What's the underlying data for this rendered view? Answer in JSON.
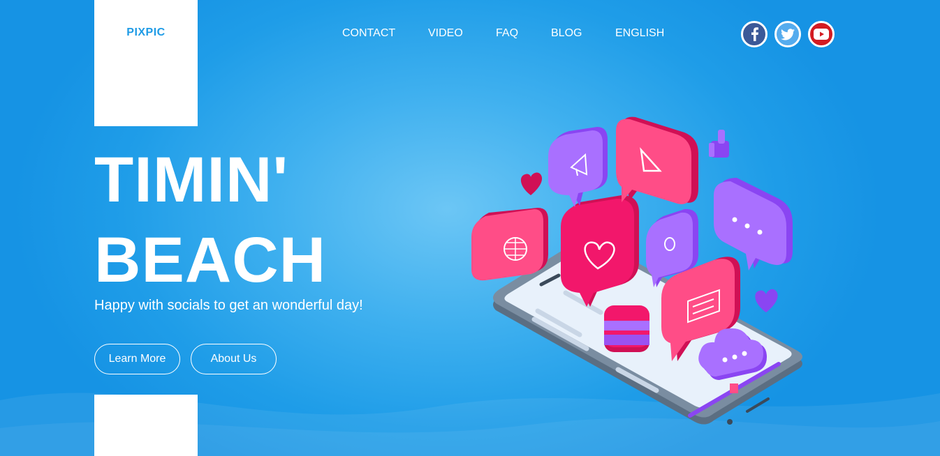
{
  "brand": {
    "logo_text": "PIXPIC"
  },
  "nav": {
    "items": [
      "CONTACT",
      "VIDEO",
      "FAQ",
      "BLOG",
      "ENGLISH"
    ]
  },
  "social": [
    {
      "name": "facebook",
      "icon": "facebook-icon",
      "color": "#3b5998"
    },
    {
      "name": "twitter",
      "icon": "twitter-icon",
      "color": "#1da1f2"
    },
    {
      "name": "youtube",
      "icon": "youtube-icon",
      "color": "#e62117"
    }
  ],
  "hero": {
    "title_line1": "TIMIN'",
    "title_line2": "BEACH",
    "subtitle": "Happy with socials to get an wonderful day!",
    "primary_button": "Learn More",
    "secondary_button": "About Us"
  },
  "colors": {
    "background": "#1f9de8",
    "accent": "#1e9be6",
    "pink": "#f2176b",
    "purple": "#a05cf7"
  }
}
